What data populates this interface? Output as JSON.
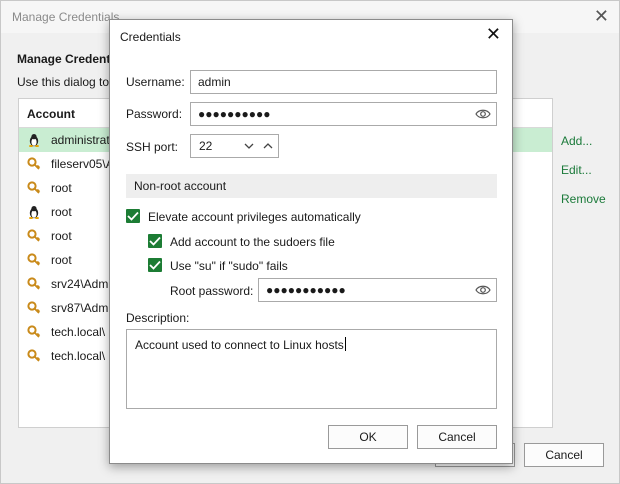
{
  "background_window": {
    "title": "Manage Credentials",
    "heading": "Manage Credent",
    "description": "Use this dialog to",
    "column_header": "Account",
    "rows": [
      {
        "icon": "linux-penguin-icon",
        "label": "administrat",
        "selected": true
      },
      {
        "icon": "key-icon",
        "label": "fileserv05\\A",
        "selected": false
      },
      {
        "icon": "key-icon",
        "label": "root",
        "selected": false
      },
      {
        "icon": "linux-penguin-icon",
        "label": "root",
        "selected": false
      },
      {
        "icon": "key-icon",
        "label": "root",
        "selected": false
      },
      {
        "icon": "key-icon",
        "label": "root",
        "selected": false
      },
      {
        "icon": "key-icon",
        "label": "srv24\\Adm",
        "selected": false
      },
      {
        "icon": "key-icon",
        "label": "srv87\\Adm",
        "selected": false
      },
      {
        "icon": "key-icon",
        "label": "tech.local\\",
        "selected": false
      },
      {
        "icon": "key-icon",
        "label": "tech.local\\",
        "selected": false
      }
    ],
    "actions": {
      "add": "Add...",
      "edit": "Edit...",
      "remove": "Remove"
    },
    "cancel_label": "Cancel"
  },
  "dialog": {
    "title": "Credentials",
    "username_label": "Username:",
    "username_value": "admin",
    "password_label": "Password:",
    "password_value": "●●●●●●●●●●",
    "ssh_port_label": "SSH port:",
    "ssh_port_value": "22",
    "section_label": "Non-root account",
    "elevate_label": "Elevate account privileges automatically",
    "sudoers_label": "Add account to the sudoers file",
    "su_label": "Use \"su\" if \"sudo\" fails",
    "root_password_label": "Root password:",
    "root_password_value": "●●●●●●●●●●●",
    "description_label": "Description:",
    "description_value": "Account used to connect to Linux hosts",
    "ok_label": "OK",
    "cancel_label": "Cancel"
  },
  "colors": {
    "accent": "#1c7c34",
    "selected_row": "#c9edd2",
    "link": "#1b7a3a"
  }
}
